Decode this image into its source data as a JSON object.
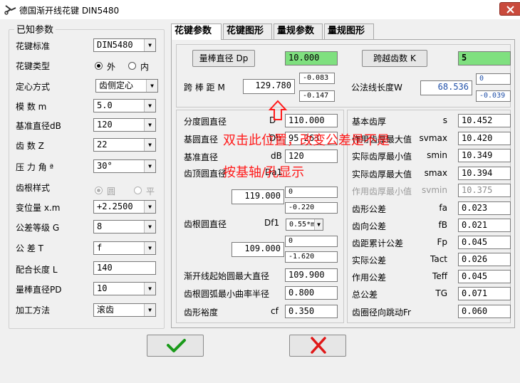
{
  "window": {
    "title": "德国渐开线花键  DIN5480",
    "icon": "scissors-icon"
  },
  "known": {
    "title": "已知参数",
    "spline_standard": {
      "label": "花键标准",
      "value": "DIN5480"
    },
    "spline_type": {
      "label": "花键类型",
      "options": [
        "外",
        "内"
      ],
      "selected": "外"
    },
    "centering": {
      "label": "定心方式",
      "value": "齿侧定心"
    },
    "module": {
      "label": "模    数 m",
      "value": "5.0"
    },
    "ref_diameter": {
      "label": "基准直径dB",
      "value": "120"
    },
    "teeth": {
      "label": "齿    数 Z",
      "value": "22"
    },
    "pressure_angle": {
      "label": "压 力 角 ª",
      "value": "30°"
    },
    "root_style": {
      "label": "齿根样式",
      "options": [
        "圆",
        "平"
      ],
      "selected": "圆"
    },
    "profile_shift": {
      "label": "变位量 x.m",
      "value": "+2.2500"
    },
    "tolerance_grade": {
      "label": "公差等级 G",
      "value": "8"
    },
    "tolerance": {
      "label": "公    差  T",
      "value": "f"
    },
    "mating_length": {
      "label": "配合长度 L",
      "value": "140"
    },
    "pin_diameter": {
      "label": "量棒直径PD",
      "value": "10"
    },
    "machining": {
      "label": "加工方法",
      "value": "滚齿"
    }
  },
  "tabs": [
    "花键参数",
    "花键图形",
    "量规参数",
    "量规图形"
  ],
  "measure": {
    "pin_button": "量棒直径 Dp",
    "pin_value": "10.000",
    "span_button": "跨越齿数  K",
    "span_value": "5",
    "over_pins_label": "跨 棒 距  M",
    "over_pins_value": "129.780",
    "over_pins_upper": "-0.083",
    "over_pins_lower": "-0.147",
    "span_length_label": "公法线长度W",
    "span_length_value": "68.536",
    "span_length_upper": "0",
    "span_length_lower": "-0.039"
  },
  "left_params": {
    "pitch_dia": {
      "label": "分度圆直径",
      "sym": "D",
      "value": "110.000"
    },
    "base_dia": {
      "label": "基圆直径",
      "sym": "Db",
      "value": "95.263"
    },
    "ref_dia": {
      "label": "基准直径",
      "sym": "dB",
      "value": "120"
    },
    "tip_dia": {
      "label": "齿顶圆直径",
      "sym": "Da1",
      "value": "119.000",
      "upper": "0",
      "lower": "-0.220"
    },
    "root_dia": {
      "label": "齿根圆直径",
      "sym": "Df1",
      "option": "0.55*m",
      "value": "109.000",
      "upper": "0",
      "lower": "-1.620"
    },
    "form_dia": {
      "label": "渐开线起始圆最大直径",
      "value": "109.900"
    },
    "root_radius": {
      "label": "齿根圆弧最小曲率半径",
      "value": "0.800"
    },
    "form_clearance": {
      "label": "齿形裕度",
      "sym": "cf",
      "value": "0.350"
    }
  },
  "right_params": [
    {
      "label": "基本齿厚",
      "sym": "s",
      "value": "10.452",
      "disabled": false
    },
    {
      "label": "作用齿厚最大值",
      "sym": "svmax",
      "value": "10.420",
      "disabled": false
    },
    {
      "label": "实际齿厚最小值",
      "sym": "smin",
      "value": "10.349",
      "disabled": false
    },
    {
      "label": "实际齿厚最大值",
      "sym": "smax",
      "value": "10.394",
      "disabled": false
    },
    {
      "label": "作用齿厚最小值",
      "sym": "svmin",
      "value": "10.375",
      "disabled": true
    },
    {
      "label": "齿形公差",
      "sym": "fa",
      "value": "0.023",
      "disabled": false
    },
    {
      "label": "齿向公差",
      "sym": "fB",
      "value": "0.021",
      "disabled": false
    },
    {
      "label": "齿距累计公差",
      "sym": "Fp",
      "value": "0.045",
      "disabled": false
    },
    {
      "label": "实际公差",
      "sym": "Tact",
      "value": "0.026",
      "disabled": false
    },
    {
      "label": "作用公差",
      "sym": "Teff",
      "value": "0.045",
      "disabled": false
    },
    {
      "label": "总公差",
      "sym": "TG",
      "value": "0.071",
      "disabled": false
    },
    {
      "label": "齿圈径向跳动Fr",
      "sym": "",
      "value": "0.060",
      "disabled": false
    }
  ],
  "annotation": {
    "line1": "双击此位置，改变公差是不是",
    "line2": "按基轴/孔显示",
    "color": "#ff1a1a"
  },
  "actions": {
    "ok_icon": "check-icon",
    "cancel_icon": "x-icon",
    "ok_color": "#1a9a1a",
    "cancel_color": "#e01818"
  },
  "colors": {
    "green_field": "#7fe07f",
    "blue_text": "#1f4fa8",
    "close_button": "#c94a3c"
  }
}
